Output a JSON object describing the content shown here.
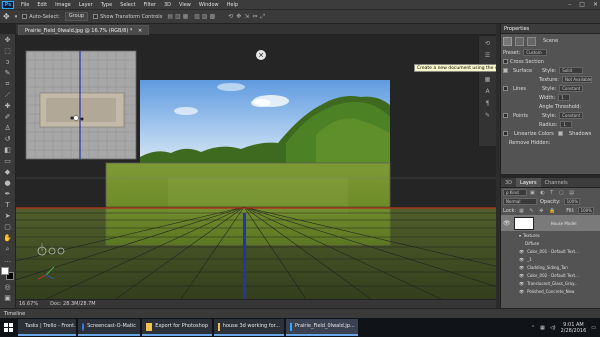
{
  "menubar": {
    "logo": "Ps",
    "items": [
      "File",
      "Edit",
      "Image",
      "Layer",
      "Type",
      "Select",
      "Filter",
      "3D",
      "View",
      "Window",
      "Help"
    ],
    "window_controls": [
      "–",
      "□",
      "✕"
    ]
  },
  "options": {
    "auto_select_label": "Auto-Select:",
    "auto_select_value": "Group",
    "show_transform_label": "Show Transform Controls"
  },
  "document": {
    "tab_title": "Prairie_Field_0lwald.jpg @ 16.7% (RGB/8) *",
    "close_glyph": "✕"
  },
  "status": {
    "zoom": "16.67%",
    "doc": "Doc: 28.3M/28.7M"
  },
  "timeline": {
    "label": "Timeline"
  },
  "tooltip": "Create a new document using the specified settings",
  "properties": {
    "tab": "Properties",
    "scene_label": "Scene",
    "preset_label": "Preset:",
    "preset_value": "Custom",
    "cross_section": "Cross Section",
    "surface": "Surface",
    "surface_style_label": "Style:",
    "surface_style": "Solid",
    "surface_texture_label": "Texture:",
    "surface_texture": "Not Available",
    "lines": "Lines",
    "lines_style_label": "Style:",
    "lines_style": "Constant",
    "width_label": "Width:",
    "width_value": "1",
    "angle_threshold": "Angle Threshold:",
    "points": "Points",
    "points_style_label": "Style:",
    "points_style": "Constant",
    "radius_label": "Radius:",
    "radius_value": "1",
    "linearize_colors": "Linearize Colors",
    "shadows": "Shadows",
    "remove_hidden": "Remove Hidden:"
  },
  "layers": {
    "tabs": [
      "3D",
      "Layers",
      "Channels"
    ],
    "kind_label": "ρ Kind",
    "blend_mode": "Normal",
    "opacity_label": "Opacity:",
    "opacity": "100%",
    "lock_label": "Lock:",
    "fill_label": "Fill:",
    "fill": "100%",
    "rows": [
      {
        "name": "House Model",
        "indent": 0
      },
      {
        "name": "Textures",
        "indent": 1
      },
      {
        "name": "Diffuse",
        "indent": 2
      },
      {
        "name": "Color_001 - Default Text...",
        "indent": 3
      },
      {
        "name": "_1",
        "indent": 3
      },
      {
        "name": "Cladding_Siding_Tan",
        "indent": 3
      },
      {
        "name": "Color_002 - Default Text...",
        "indent": 3
      },
      {
        "name": "Translucent_Glass_Gray...",
        "indent": 3
      },
      {
        "name": "Polished_Concrete_New",
        "indent": 3
      }
    ]
  },
  "taskbar": {
    "apps": [
      {
        "label": "Tasks | Trello - Front...",
        "color": "#e8743b"
      },
      {
        "label": "Screencast-O-Matic",
        "color": "#3b7de8"
      },
      {
        "label": "Export for Photoshop",
        "color": "#f2c14e"
      },
      {
        "label": "house 3d working for...",
        "color": "#f2c14e"
      },
      {
        "label": "Prairie_Field_0lwald.jp...",
        "color": "#31a8ff"
      }
    ],
    "time": "9:01 AM",
    "date": "2/28/2016"
  },
  "colors": {
    "ps_blue": "#31a8ff",
    "red_axis": "#b12a1a",
    "blue_axis": "#2236a8"
  }
}
